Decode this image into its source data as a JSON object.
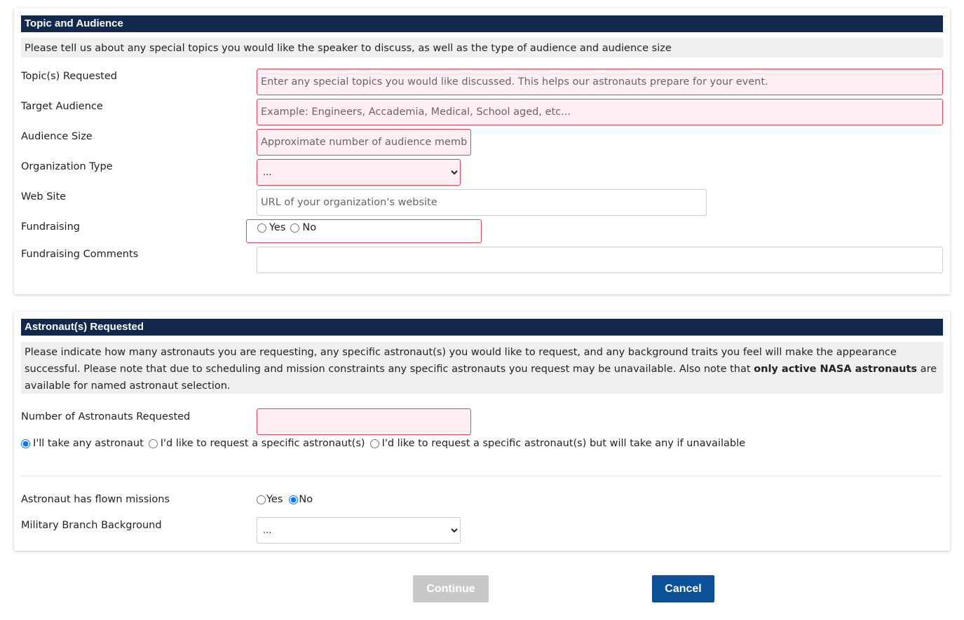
{
  "topic_section": {
    "title": "Topic and Audience",
    "intro": "Please tell us about any special topics you would like the speaker to discuss, as well as the type of audience and audience size",
    "fields": {
      "topics": {
        "label": "Topic(s) Requested",
        "placeholder": "Enter any special topics you would like discussed. This helps our astronauts prepare for your event."
      },
      "audience": {
        "label": "Target Audience",
        "placeholder": "Example: Engineers, Accademia, Medical, School aged, etc..."
      },
      "size": {
        "label": "Audience Size",
        "placeholder": "Approximate number of audience members"
      },
      "org_type": {
        "label": "Organization Type",
        "selected": "..."
      },
      "website": {
        "label": "Web Site",
        "placeholder": "URL of your organization's website"
      },
      "fundraising": {
        "label": "Fundraising",
        "yes": "Yes",
        "no": "No"
      },
      "fundraising_comments": {
        "label": "Fundraising Comments",
        "value": ""
      }
    }
  },
  "astronaut_section": {
    "title": "Astronaut(s) Requested",
    "intro_1": "Please indicate how many astronauts you are requesting, any specific astronaut(s) you would like to request, and any background traits you feel will make the appearance successful. Please note that due to scheduling and mission constraints any specific astronauts you request may be unavailable. Also note that ",
    "intro_bold": "only active NASA astronauts",
    "intro_2": " are available for named astronaut selection.",
    "number_label": "Number of Astronauts Requested",
    "number_value": "",
    "preference_options": [
      "I'll take any astronaut",
      "I'd like to request a specific astronaut(s)",
      "I'd like to request a specific astronaut(s) but will take any if unavailable"
    ],
    "preference_selected": 0,
    "flown_label": "Astronaut has flown missions",
    "flown_yes": "Yes",
    "flown_no": "No",
    "flown_selected": "No",
    "military_label": "Military Branch Background",
    "military_selected": "..."
  },
  "buttons": {
    "continue": "Continue",
    "cancel": "Cancel"
  },
  "colors": {
    "header_bg": "#13284d",
    "invalid_bg": "#ffeef2",
    "invalid_border": "#d6485c",
    "cancel_bg": "#0a5198",
    "continue_disabled_bg": "#c8c8c8"
  }
}
